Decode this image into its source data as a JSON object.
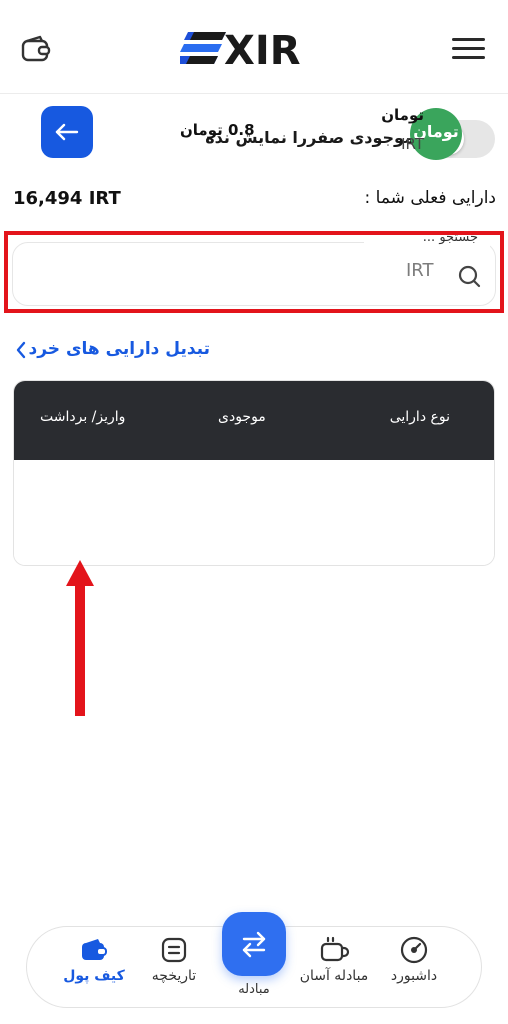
{
  "header": {
    "logo_text": "XIR",
    "menu_icon": "hamburger-icon",
    "wallet_icon": "wallet-icon"
  },
  "settings": {
    "hide_zero_label": "موجودی صفررا نمایش نده",
    "hide_zero_enabled": false
  },
  "balance": {
    "label": "دارایی فعلی شما :",
    "value": "16,494 IRT"
  },
  "search": {
    "legend": "جستجو ...",
    "value": "IRT",
    "icon": "search-icon"
  },
  "small_assets": {
    "label": "تبدیل دارایی های خرد",
    "icon": "chevron-left-icon"
  },
  "table": {
    "headers": {
      "asset_type": "نوع دارایی",
      "balance": "موجودی",
      "action": "واریز/ برداشت"
    },
    "rows": [
      {
        "logo_text": "تومان",
        "name": "تومان",
        "code": "IRT",
        "balance": "0.8 تومان",
        "action_icon": "arrow-left-icon"
      }
    ]
  },
  "bottom_nav": {
    "items": [
      {
        "label": "داشبورد",
        "icon": "dashboard-icon"
      },
      {
        "label": "مبادله آسان",
        "icon": "coffee-cup-icon"
      },
      {
        "label": "مبادله",
        "icon": "swap-icon"
      },
      {
        "label": "تاریخچه",
        "icon": "history-icon"
      },
      {
        "label": "کیف پول",
        "icon": "wallet-icon",
        "active": true
      }
    ]
  },
  "colors": {
    "accent": "#1759e0",
    "highlight": "#e3141b",
    "table_header": "#2a2c30",
    "asset_green": "#3aa55c"
  }
}
